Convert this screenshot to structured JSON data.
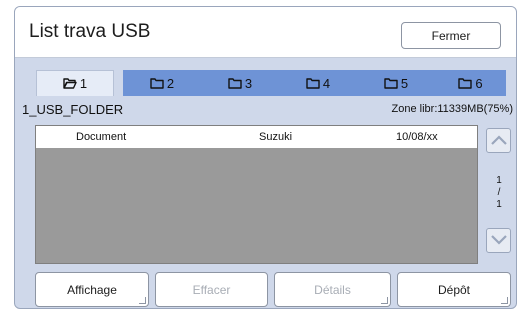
{
  "window": {
    "title": "List trava USB",
    "close_label": "Fermer"
  },
  "tabs": [
    {
      "label": "1",
      "active": true
    },
    {
      "label": "2",
      "active": false
    },
    {
      "label": "3",
      "active": false
    },
    {
      "label": "4",
      "active": false
    },
    {
      "label": "5",
      "active": false
    },
    {
      "label": "6",
      "active": false
    }
  ],
  "folder": {
    "name": "1_USB_FOLDER",
    "zone": "Zone libr:11339MB(75%)"
  },
  "list": {
    "rows": [
      {
        "name": "Document",
        "owner": "Suzuki",
        "date": "10/08/xx"
      }
    ]
  },
  "pager": {
    "current": "1",
    "sep": "/",
    "total": "1"
  },
  "actions": {
    "display_label": "Affichage",
    "delete_label": "Effacer",
    "details_label": "Détails",
    "deposit_label": "Dépôt"
  },
  "colors": {
    "tab_inactive": "#6e93d6",
    "panel_bg": "#cfd8ea",
    "list_bg": "#9a9a9a"
  },
  "icons": {
    "tab_icon": "folder-icon",
    "scroll_up": "chevron-up-icon",
    "scroll_down": "chevron-down-icon"
  }
}
